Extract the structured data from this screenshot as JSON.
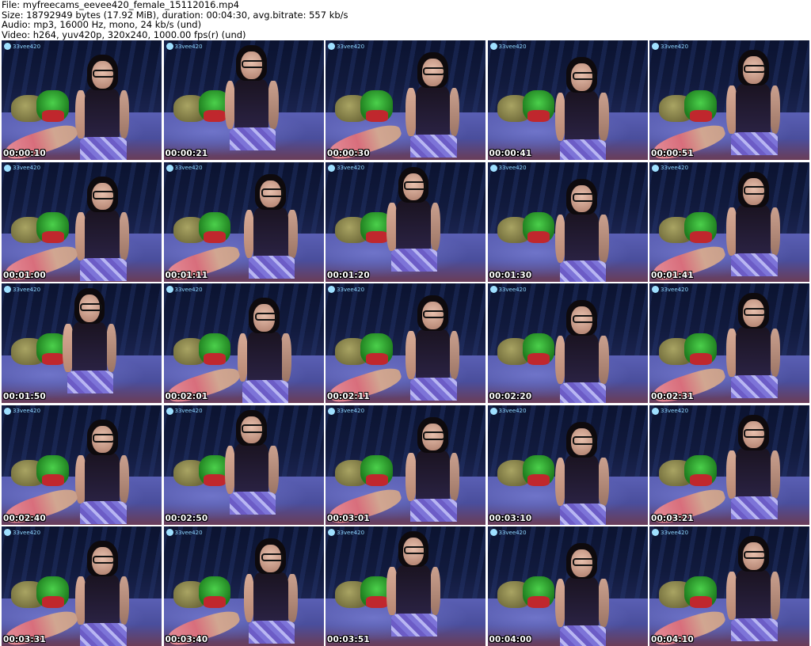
{
  "header": {
    "line1": "File: myfreecams_eevee420_female_15112016.mp4",
    "line2": "Size: 18792949 bytes (17.92 MiB), duration: 00:04:30, avg.bitrate: 557 kb/s",
    "line3": "Audio: mp3, 16000 Hz, mono, 24 kb/s (und)",
    "line4": "Video: h264, yuv420p, 320x240, 1000.00 fps(r) (und)"
  },
  "thumbnails": [
    {
      "timestamp": "00:00:10",
      "watermark": "33vee420"
    },
    {
      "timestamp": "00:00:21",
      "watermark": "33vee420"
    },
    {
      "timestamp": "00:00:30",
      "watermark": "33vee420"
    },
    {
      "timestamp": "00:00:41",
      "watermark": "33vee420"
    },
    {
      "timestamp": "00:00:51",
      "watermark": "33vee420"
    },
    {
      "timestamp": "00:01:00",
      "watermark": "33vee420"
    },
    {
      "timestamp": "00:01:11",
      "watermark": "33vee420"
    },
    {
      "timestamp": "00:01:20",
      "watermark": "33vee420"
    },
    {
      "timestamp": "00:01:30",
      "watermark": "33vee420"
    },
    {
      "timestamp": "00:01:41",
      "watermark": "33vee420"
    },
    {
      "timestamp": "00:01:50",
      "watermark": "33vee420"
    },
    {
      "timestamp": "00:02:01",
      "watermark": "33vee420"
    },
    {
      "timestamp": "00:02:11",
      "watermark": "33vee420"
    },
    {
      "timestamp": "00:02:20",
      "watermark": "33vee420"
    },
    {
      "timestamp": "00:02:31",
      "watermark": "33vee420"
    },
    {
      "timestamp": "00:02:40",
      "watermark": "33vee420"
    },
    {
      "timestamp": "00:02:50",
      "watermark": "33vee420"
    },
    {
      "timestamp": "00:03:01",
      "watermark": "33vee420"
    },
    {
      "timestamp": "00:03:10",
      "watermark": "33vee420"
    },
    {
      "timestamp": "00:03:21",
      "watermark": "33vee420"
    },
    {
      "timestamp": "00:03:31",
      "watermark": "33vee420"
    },
    {
      "timestamp": "00:03:40",
      "watermark": "33vee420"
    },
    {
      "timestamp": "00:03:51",
      "watermark": "33vee420"
    },
    {
      "timestamp": "00:04:00",
      "watermark": "33vee420"
    },
    {
      "timestamp": "00:04:10",
      "watermark": "33vee420"
    }
  ]
}
